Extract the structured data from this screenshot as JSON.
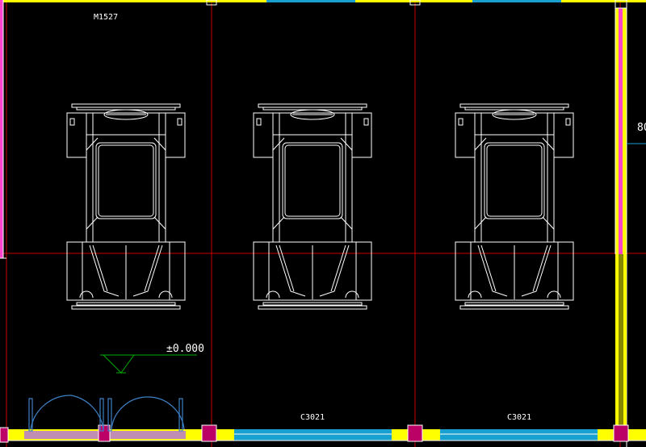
{
  "drawing": {
    "background_color": "#000000",
    "labels": {
      "door_tag": "M1527",
      "window_tag_1": "C3021",
      "window_tag_2": "C3021",
      "elevation": "±0.000",
      "edge_dimension": "80"
    },
    "colors": {
      "axis_line": "#cc0000",
      "wall_yellow": "#ffff00",
      "wall_magenta": "#ff44cc",
      "window_cyan": "#18a0d0",
      "door_blue": "#3d82c8",
      "door_violet": "#b070e0",
      "column_magenta": "#bb0066",
      "fixture_white": "#ffffff",
      "elevation_mark_green": "#00b000"
    },
    "fixtures": {
      "count": 3,
      "name": "machine-unit"
    }
  }
}
